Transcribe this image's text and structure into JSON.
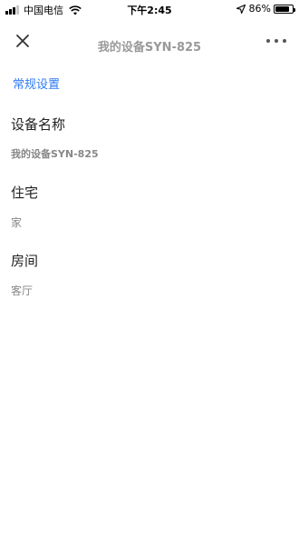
{
  "status_bar": {
    "carrier": "中国电信",
    "time": "下午2:45",
    "battery_pct": "86%",
    "battery_level": 0.86,
    "icons": [
      "signal-icon",
      "wifi-icon",
      "location-icon",
      "battery-icon"
    ]
  },
  "nav": {
    "title": "我的设备SYN-825",
    "close_icon": "close-icon",
    "more_icon": "more-icon"
  },
  "section_link": "常规设置",
  "fields": {
    "device_name": {
      "label": "设备名称",
      "value": "我的设备SYN-825"
    },
    "home": {
      "label": "住宅",
      "value": "家"
    },
    "room": {
      "label": "房间",
      "value": "客厅"
    }
  },
  "colors": {
    "accent": "#2f7bf5",
    "title_gray": "#9a9a9a",
    "value_gray": "#888888"
  }
}
